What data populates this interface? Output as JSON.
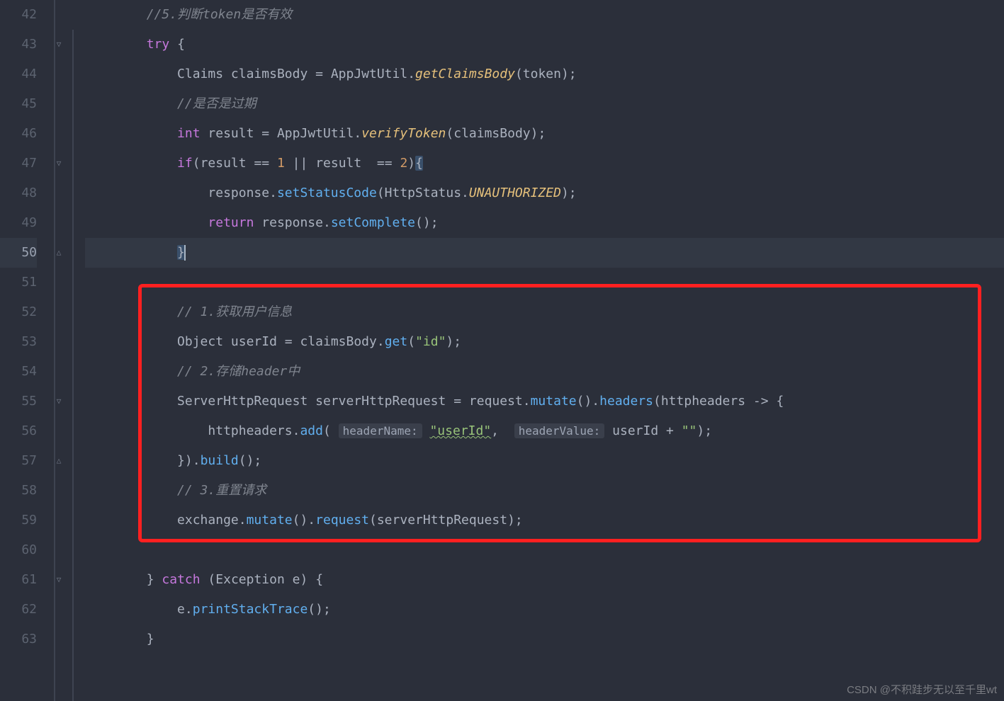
{
  "lineNumbers": [
    "42",
    "43",
    "44",
    "45",
    "46",
    "47",
    "48",
    "49",
    "50",
    "51",
    "52",
    "53",
    "54",
    "55",
    "56",
    "57",
    "58",
    "59",
    "60",
    "61",
    "62",
    "63"
  ],
  "currentLine": 50,
  "highlightBox": {
    "startLine": 52,
    "endLine": 59
  },
  "code": {
    "l42_comment": "//5.判断token是否有效",
    "l43_try": "try",
    "l44_type": "Claims",
    "l44_var": "claimsBody",
    "l44_cls": "AppJwtUtil",
    "l44_method": "getClaimsBody",
    "l44_arg": "token",
    "l45_comment": "//是否是过期",
    "l46_kw": "int",
    "l46_var": "result",
    "l46_cls": "AppJwtUtil",
    "l46_method": "verifyToken",
    "l46_arg": "claimsBody",
    "l47_if": "if",
    "l47_var": "result",
    "l47_n1": "1",
    "l47_n2": "2",
    "l48_obj": "response",
    "l48_method": "setStatusCode",
    "l48_cls": "HttpStatus",
    "l48_field": "UNAUTHORIZED",
    "l49_return": "return",
    "l49_obj": "response",
    "l49_method": "setComplete",
    "l52_comment": "// 1.获取用户信息",
    "l53_type": "Object",
    "l53_var": "userId",
    "l53_obj": "claimsBody",
    "l53_method": "get",
    "l53_str": "\"id\"",
    "l54_comment": "// 2.存储header中",
    "l55_type": "ServerHttpRequest",
    "l55_var": "serverHttpRequest",
    "l55_obj": "request",
    "l55_m1": "mutate",
    "l55_m2": "headers",
    "l55_lambda": "httpheaders",
    "l56_obj": "httpheaders",
    "l56_method": "add",
    "l56_hint1": "headerName:",
    "l56_str1": "\"userId\"",
    "l56_hint2": "headerValue:",
    "l56_var": "userId",
    "l56_str2": "\"\"",
    "l57_method": "build",
    "l58_comment": "// 3.重置请求",
    "l59_obj": "exchange",
    "l59_m1": "mutate",
    "l59_m2": "request",
    "l59_arg": "serverHttpRequest",
    "l61_catch": "catch",
    "l61_type": "Exception",
    "l61_var": "e",
    "l62_obj": "e",
    "l62_method": "printStackTrace"
  },
  "watermark": "CSDN @不积跬步无以至千里wt"
}
